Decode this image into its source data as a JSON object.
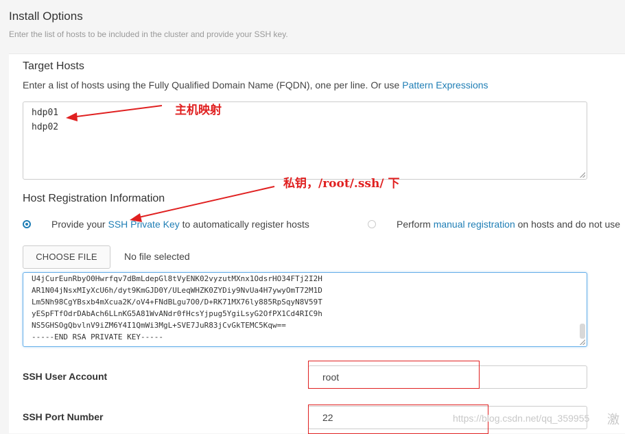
{
  "header": {
    "title": "Install Options",
    "subtitle": "Enter the list of hosts to be included in the cluster and provide your SSH key."
  },
  "target_hosts": {
    "title": "Target Hosts",
    "desc_prefix": "Enter a list of hosts using the Fully Qualified Domain Name (FQDN), one per line. Or use ",
    "desc_link": "Pattern Expressions",
    "hosts": [
      "hdp01",
      "hdp02"
    ]
  },
  "registration": {
    "title": "Host Registration Information",
    "option1_prefix": "Provide your ",
    "option1_link": "SSH Private Key",
    "option1_suffix": " to automatically register hosts",
    "option2_prefix": "Perform ",
    "option2_link": "manual registration",
    "option2_suffix": " on hosts and do not use",
    "choose_file": "CHOOSE FILE",
    "no_file": "No file selected",
    "key_lines": [
      "U4jCurEunRbyO0Hwrfqv7dBmLdepGl8tVyENK02vyzutMXnx1OdsrHO34FTj2I2H",
      "AR1N04jNsxMIyXcU6h/dyt9KmGJD0Y/ULeqWHZK0ZYDiy9NvUa4H7ywyOmT72M1D",
      "Lm5Nh98CgYBsxb4mXcua2K/oV4+FNdBLgu7O0/D+RK71MX76ly885RpSqyN8V59T",
      "yESpFTfOdrDAbAch6LLnKG5A81WvANdr0fHcsYjpug5YgiLsyG2OfPX1Cd4RIC9h",
      "NS5GHSOgQbvlnV9iZM6Y4I1QmWi3MgL+SVE7JuR83jCvGkTEMC5Kqw==",
      "-----END RSA PRIVATE KEY-----"
    ]
  },
  "ssh": {
    "user_label": "SSH User Account",
    "user_value": "root",
    "port_label": "SSH Port Number",
    "port_value": "22"
  },
  "annotations": {
    "hosts_note": "主机映射",
    "key_note": "私钥，/root/.ssh/ 下",
    "color": "#e02020"
  },
  "watermark": {
    "url": "https://blog.csdn.net/qq_359955",
    "extra": "激"
  }
}
